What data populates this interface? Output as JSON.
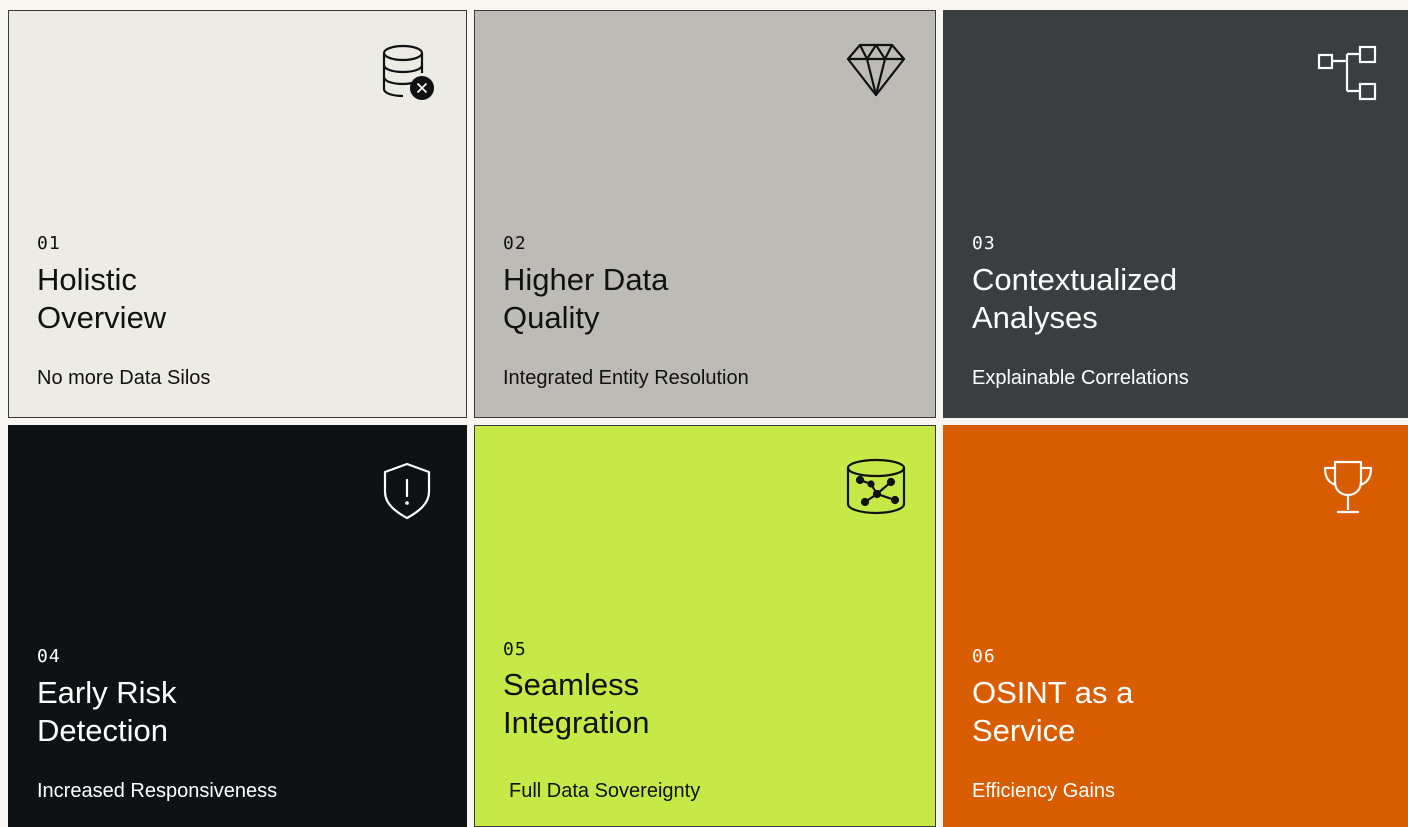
{
  "cards": [
    {
      "number": "01",
      "title": "Holistic\nOverview",
      "subtitle": "No more Data Silos",
      "icon": "database-x-icon"
    },
    {
      "number": "02",
      "title": "Higher Data\nQuality",
      "subtitle": "Integrated Entity Resolution",
      "icon": "diamond-icon"
    },
    {
      "number": "03",
      "title": "Contextualized\nAnalyses",
      "subtitle": "Explainable Correlations",
      "icon": "tree-structure-icon"
    },
    {
      "number": "04",
      "title": "Early Risk\nDetection",
      "subtitle": "Increased Responsiveness",
      "icon": "shield-alert-icon"
    },
    {
      "number": "05",
      "title": "Seamless\nIntegration",
      "subtitle": "Full Data Sovereignty",
      "icon": "database-network-icon"
    },
    {
      "number": "06",
      "title": "OSINT as a\nService",
      "subtitle": "Efficiency Gains",
      "icon": "trophy-icon"
    }
  ],
  "colors": {
    "card1_bg": "#ecebe4",
    "card2_bg": "#bdbbb6",
    "card3_bg": "#3b3e41",
    "card4_bg": "#0e1215",
    "card5_bg": "#c7e947",
    "card6_bg": "#d85c00"
  }
}
